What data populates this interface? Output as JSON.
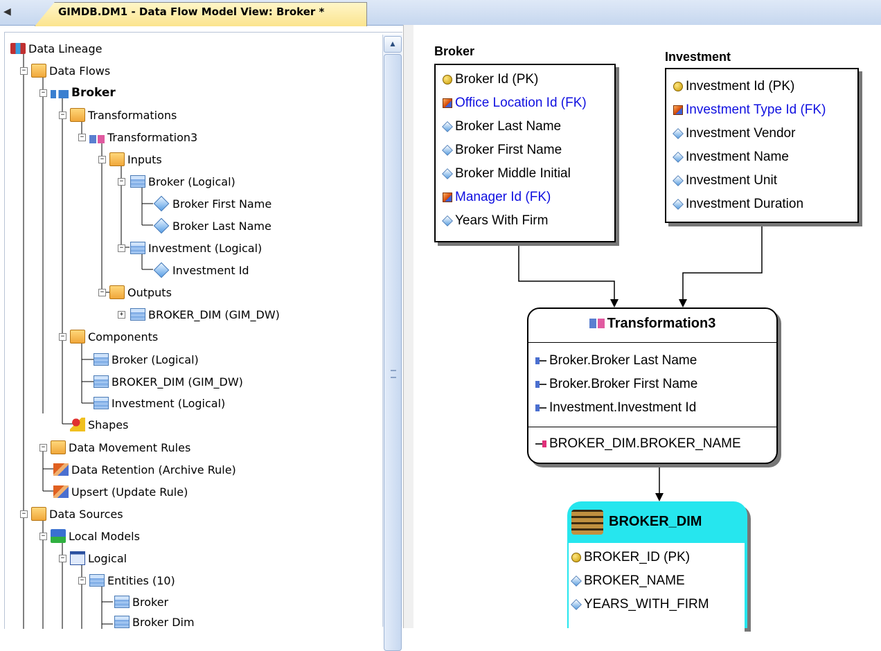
{
  "tab": {
    "title": "GIMDB.DM1 - Data Flow Model View: Broker *"
  },
  "tree": {
    "data_lineage": "Data Lineage",
    "data_flows": "Data Flows",
    "broker": "Broker",
    "transformations": "Transformations",
    "transformation3": "Transformation3",
    "inputs": "Inputs",
    "broker_logical": "Broker (Logical)",
    "broker_first_name": "Broker First Name",
    "broker_last_name": "Broker Last Name",
    "investment_logical": "Investment (Logical)",
    "investment_id": "Investment Id",
    "outputs": "Outputs",
    "broker_dim_gim_dw": "BROKER_DIM (GIM_DW)",
    "components": "Components",
    "comp_broker_logical": "Broker (Logical)",
    "comp_broker_dim": "BROKER_DIM (GIM_DW)",
    "comp_investment_logical": "Investment (Logical)",
    "shapes": "Shapes",
    "data_movement_rules": "Data Movement Rules",
    "data_retention": "Data Retention (Archive Rule)",
    "upsert": "Upsert (Update Rule)",
    "data_sources": "Data Sources",
    "local_models": "Local Models",
    "logical": "Logical",
    "entities": "Entities (10)",
    "ent_broker": "Broker",
    "ent_broker_dim": "Broker Dim"
  },
  "diagram": {
    "broker": {
      "title": "Broker",
      "attributes": [
        {
          "text": "Broker Id (PK)",
          "kind": "pk"
        },
        {
          "text": "Office Location Id (FK)",
          "kind": "fk"
        },
        {
          "text": "Broker Last Name",
          "kind": "attr"
        },
        {
          "text": "Broker First Name",
          "kind": "attr"
        },
        {
          "text": "Broker Middle Initial",
          "kind": "attr"
        },
        {
          "text": "Manager Id (FK)",
          "kind": "fk"
        },
        {
          "text": "Years With Firm",
          "kind": "attr"
        }
      ]
    },
    "investment": {
      "title": "Investment",
      "attributes": [
        {
          "text": "Investment Id (PK)",
          "kind": "pk"
        },
        {
          "text": "Investment Type Id (FK)",
          "kind": "fk"
        },
        {
          "text": "Investment Vendor",
          "kind": "attr"
        },
        {
          "text": "Investment Name",
          "kind": "attr"
        },
        {
          "text": "Investment Unit",
          "kind": "attr"
        },
        {
          "text": "Investment Duration",
          "kind": "attr"
        }
      ]
    },
    "transformation": {
      "title": "Transformation3",
      "inputs": [
        "Broker.Broker Last Name",
        "Broker.Broker First Name",
        "Investment.Investment Id"
      ],
      "output": "BROKER_DIM.BROKER_NAME"
    },
    "broker_dim": {
      "title": "BROKER_DIM",
      "attributes": [
        {
          "text": "BROKER_ID (PK)",
          "kind": "pk"
        },
        {
          "text": "BROKER_NAME",
          "kind": "attr"
        },
        {
          "text": "YEARS_WITH_FIRM",
          "kind": "attr"
        }
      ]
    }
  },
  "colors": {
    "fk_text": "#1010e0",
    "dim_header": "#26e6ee",
    "tab_active": "#fbe48e"
  }
}
